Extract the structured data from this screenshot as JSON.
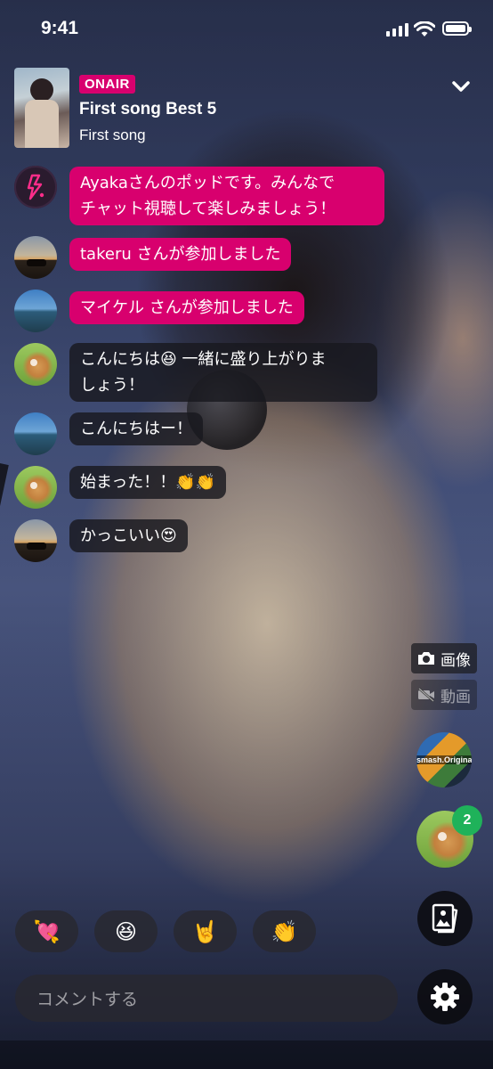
{
  "status_bar": {
    "time": "9:41"
  },
  "header": {
    "badge": "ONAIR",
    "title": "First song Best 5",
    "subtitle": "First song",
    "collapse_icon": "chevron-down-icon"
  },
  "chat": {
    "messages": [
      {
        "avatar": "bolt-logo",
        "style": "pink",
        "text_line1": "Ayakaさんのポッドです。みんなで",
        "text_line2": "チャット視聴して楽しみましょう！"
      },
      {
        "avatar": "sunset-photo",
        "style": "pink",
        "text": "takeru さんが参加しました"
      },
      {
        "avatar": "lake-photo",
        "style": "pink",
        "text": "マイケル さんが参加しました"
      },
      {
        "avatar": "dog-photo",
        "style": "dark",
        "text_line1": "こんにちは😆 一緒に盛り上がりま",
        "text_line2": "しょう！"
      },
      {
        "avatar": "lake-photo",
        "style": "dark",
        "text": "こんにちはー！"
      },
      {
        "avatar": "dog-photo",
        "style": "dark",
        "text": "始まった！！👏👏"
      },
      {
        "avatar": "sunset-photo",
        "style": "dark",
        "text": "かっこいい😍"
      }
    ]
  },
  "media": {
    "photo_label": "画像",
    "video_label": "動画"
  },
  "side": {
    "channel_label": "smash.Originals",
    "participant_count": "2"
  },
  "reactions": [
    "💘",
    "😆",
    "🤘",
    "👏"
  ],
  "comment": {
    "placeholder": "コメントする"
  },
  "colors": {
    "accent": "#d8006e",
    "badge_green": "#1fb25a"
  }
}
